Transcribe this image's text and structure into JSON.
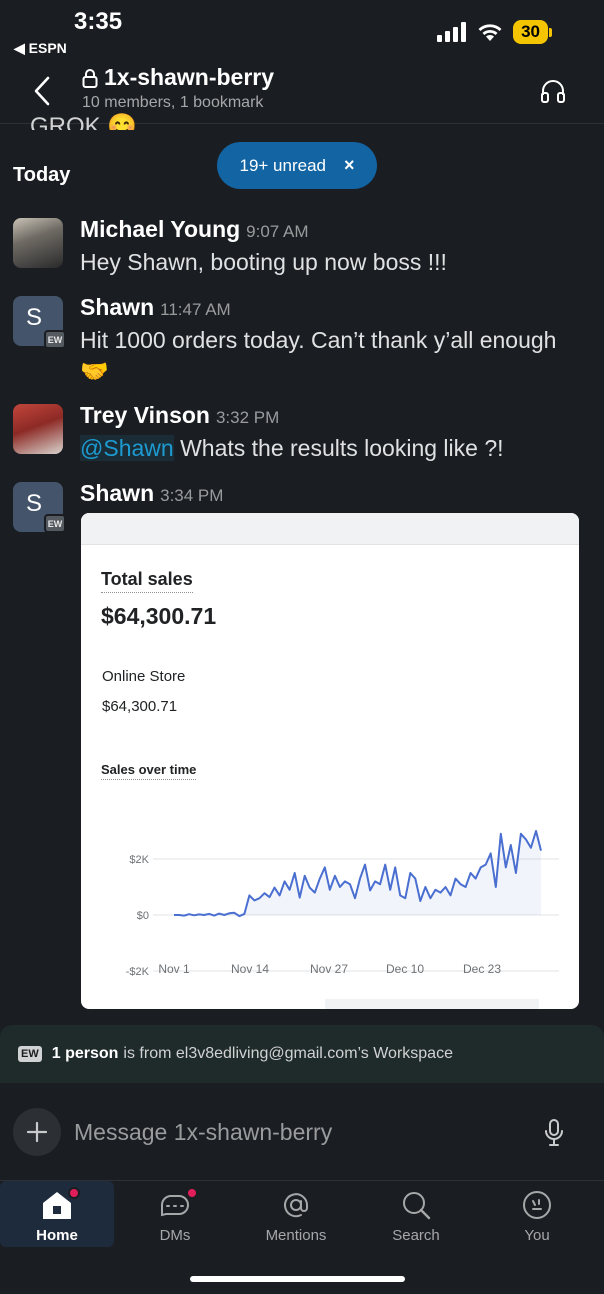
{
  "status_bar": {
    "time": "3:35",
    "back_app": "◀ ESPN",
    "battery": "30"
  },
  "header": {
    "channel_name": "1x-shawn-berry",
    "subtitle": "10 members, 1 bookmark"
  },
  "peek_text": "GROK 😊",
  "divider_label": "Today",
  "unread_pill": {
    "label": "19+ unread",
    "close": "×"
  },
  "messages": [
    {
      "sender": "Michael Young",
      "time": "9:07 AM",
      "text": "Hey Shawn, booting up now boss !!!"
    },
    {
      "sender": "Shawn",
      "avatar_letter": "S",
      "badge": "EW",
      "time": "11:47 AM",
      "text": "Hit 1000 orders today. Can’t thank y’all enough 🤝"
    },
    {
      "sender": "Trey Vinson",
      "time": "3:32 PM",
      "mention": "@Shawn",
      "text": " Whats the results looking like ?!"
    },
    {
      "sender": "Shawn",
      "avatar_letter": "S",
      "badge": "EW",
      "time": "3:34 PM"
    }
  ],
  "attachment": {
    "total_label": "Total sales",
    "total_value": "$64,300.71",
    "store_label": "Online Store",
    "store_value": "$64,300.71",
    "chart_title": "Sales over time",
    "chart_data": {
      "type": "line",
      "title": "Sales over time",
      "xlabel": "",
      "ylabel": "",
      "x_ticks": [
        "Nov 1",
        "Nov 14",
        "Nov 27",
        "Dec 10",
        "Dec 23"
      ],
      "y_ticks": [
        "$2K",
        "$0",
        "-$2K"
      ],
      "ylim": [
        -2000,
        3000
      ],
      "grid": true,
      "series": [
        {
          "color": "#4a6fd0",
          "values": [
            0,
            0,
            -20,
            30,
            -10,
            20,
            0,
            40,
            -20,
            50,
            0,
            60,
            80,
            -40,
            40,
            700,
            520,
            600,
            780,
            640,
            980,
            700,
            1200,
            900,
            1500,
            620,
            1400,
            980,
            800,
            1300,
            1700,
            900,
            1400,
            1000,
            1200,
            1100,
            600,
            1300,
            1800,
            880,
            1200,
            1100,
            1800,
            900,
            1700,
            700,
            600,
            1500,
            1300,
            500,
            1000,
            600,
            900,
            800,
            1000,
            700,
            1300,
            1100,
            1000,
            1500,
            1300,
            1700,
            1800,
            2200,
            1000,
            2900,
            1700,
            2500,
            1500,
            2900,
            2700,
            2400,
            3000,
            2300
          ]
        }
      ]
    }
  },
  "workspace_banner": {
    "chip": "EW",
    "strong": "1 person",
    "text": "is from el3v8edliving@gmail.com’s Workspace"
  },
  "composer": {
    "placeholder": "Message 1x-shawn-berry"
  },
  "tabs": [
    {
      "label": "Home",
      "icon": "home-icon",
      "active": true
    },
    {
      "label": "DMs",
      "icon": "dms-icon"
    },
    {
      "label": "Mentions",
      "icon": "mentions-icon"
    },
    {
      "label": "Search",
      "icon": "search-icon"
    },
    {
      "label": "You",
      "icon": "you-icon"
    }
  ],
  "colors": {
    "background": "#1a1d21",
    "accent": "#1264a3",
    "mention": "#1d9bd1",
    "notification": "#e01e5a",
    "battery": "#f5c400"
  }
}
